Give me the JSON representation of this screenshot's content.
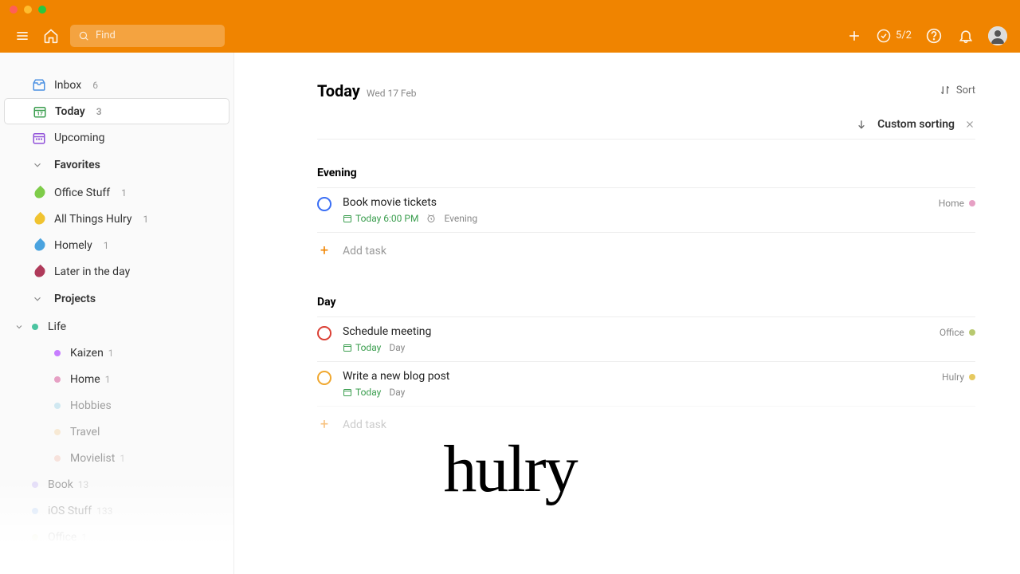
{
  "search": {
    "placeholder": "Find"
  },
  "karma": {
    "value": "5/2"
  },
  "sidebar": {
    "inbox": {
      "label": "Inbox",
      "count": "6"
    },
    "today": {
      "label": "Today",
      "count": "3"
    },
    "upcoming": {
      "label": "Upcoming"
    },
    "favorites_label": "Favorites",
    "favorites": [
      {
        "label": "Office Stuff",
        "count": "1",
        "color": "#7ecc49"
      },
      {
        "label": "All Things Hulry",
        "count": "1",
        "color": "#f0c330"
      },
      {
        "label": "Homely",
        "count": "1",
        "color": "#4aa3df"
      },
      {
        "label": "Later in the day",
        "count": "",
        "color": "#af3a5a"
      }
    ],
    "projects_label": "Projects",
    "projects": [
      {
        "label": "Life",
        "color": "#4bc4a0",
        "count": "",
        "nested": false,
        "faded": false,
        "expandable": true
      },
      {
        "label": "Kaizen",
        "color": "#c77dff",
        "count": "1",
        "nested": true,
        "faded": false
      },
      {
        "label": "Home",
        "color": "#e6a0c4",
        "count": "1",
        "nested": true,
        "faded": false
      },
      {
        "label": "Hobbies",
        "color": "#9fd3e8",
        "count": "",
        "nested": true,
        "faded": true
      },
      {
        "label": "Travel",
        "color": "#f5d6a8",
        "count": "",
        "nested": true,
        "faded": true
      },
      {
        "label": "Movielist",
        "color": "#f5c6b8",
        "count": "1",
        "nested": true,
        "faded": true
      },
      {
        "label": "Book",
        "color": "#c9b8f5",
        "count": "13",
        "nested": false,
        "faded": true
      },
      {
        "label": "iOS Stuff",
        "color": "#9fc5f5",
        "count": "133",
        "nested": false,
        "faded": true
      },
      {
        "label": "Office",
        "color": "#d4e09b",
        "count": "1",
        "nested": false,
        "faded": true
      }
    ]
  },
  "page": {
    "title": "Today",
    "date": "Wed 17 Feb",
    "sort_label": "Sort",
    "custom_sort": "Custom sorting"
  },
  "sections": [
    {
      "title": "Evening",
      "tasks": [
        {
          "title": "Book movie tickets",
          "check_color": "#3b6ff5",
          "due": "Today 6:00 PM",
          "has_reminder": true,
          "tag": "Evening",
          "project": "Home",
          "project_color": "#e6a0c4"
        }
      ],
      "add_label": "Add task",
      "add_faded": false
    },
    {
      "title": "Day",
      "tasks": [
        {
          "title": "Schedule meeting",
          "check_color": "#db4035",
          "due": "Today",
          "has_reminder": false,
          "tag": "Day",
          "project": "Office",
          "project_color": "#b8c96f"
        },
        {
          "title": "Write a new blog post",
          "check_color": "#f0a830",
          "due": "Today",
          "has_reminder": false,
          "tag": "Day",
          "project": "Hulry",
          "project_color": "#e6c960"
        }
      ],
      "add_label": "Add task",
      "add_faded": true
    }
  ],
  "watermark": "hulry"
}
